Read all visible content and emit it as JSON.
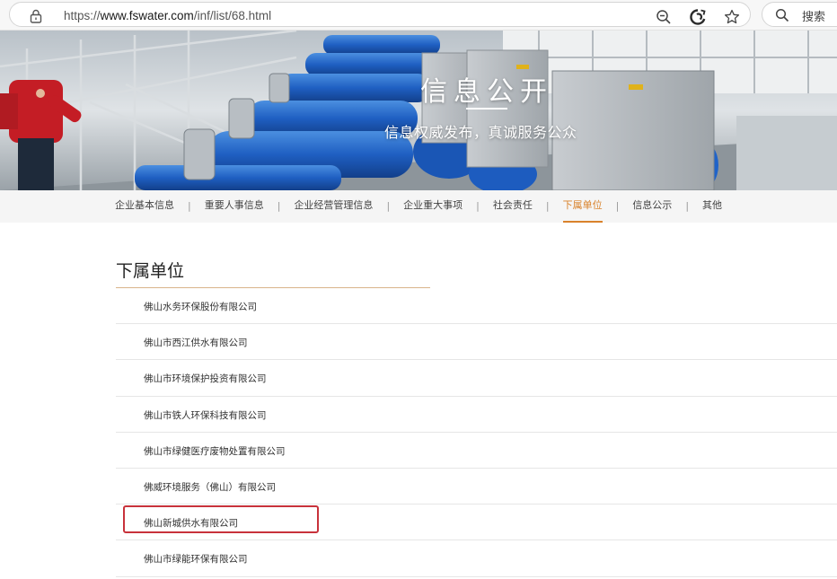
{
  "browser": {
    "url_prefix": "https://",
    "url_domain": "www.fswater.com",
    "url_path": "/inf/list/68.html",
    "icons": [
      "lock-icon",
      "zoom-out-icon",
      "edge-refresh-icon",
      "favorite-star-icon",
      "search-icon"
    ],
    "search_label": "搜索"
  },
  "banner": {
    "title": "信息公开",
    "subtitle": "信息权威发布，真诚服务公众"
  },
  "nav": {
    "items": [
      {
        "label": "企业基本信息"
      },
      {
        "label": "重要人事信息"
      },
      {
        "label": "企业经营管理信息"
      },
      {
        "label": "企业重大事项"
      },
      {
        "label": "社会责任"
      },
      {
        "label": "下属单位",
        "active": true
      },
      {
        "label": "信息公示"
      },
      {
        "label": "其他"
      }
    ],
    "separator": "|",
    "accent_color": "#d9822b"
  },
  "section": {
    "title": "下属单位",
    "companies": [
      "佛山水务环保股份有限公司",
      "佛山市西江供水有限公司",
      "佛山市环境保护投资有限公司",
      "佛山市铁人环保科技有限公司",
      "佛山市绿健医疗废物处置有限公司",
      "佛威环境服务（佛山）有限公司",
      "佛山新城供水有限公司",
      "佛山市绿能环保有限公司"
    ],
    "highlighted_company": "佛山新城供水有限公司",
    "highlight_color": "#c8323b"
  }
}
